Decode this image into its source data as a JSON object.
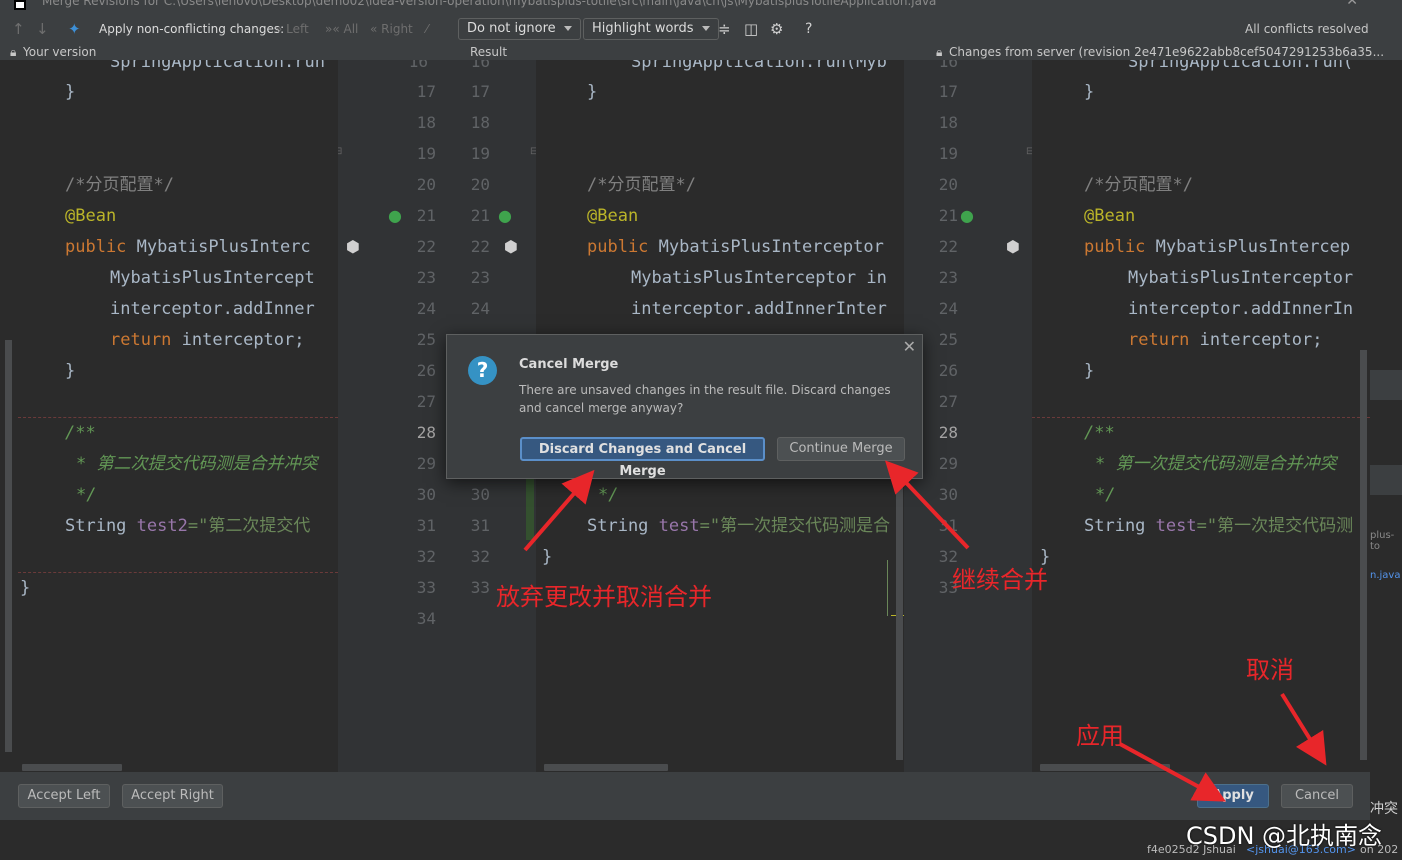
{
  "window": {
    "title": "Merge Revisions for C:\\Users\\lenovo\\Desktop\\demo02\\idea-version-operation\\mybatisplus-totile\\src\\main\\java\\cn\\js\\MybatisplusTotileApplication.java"
  },
  "toolbar": {
    "apply_nonconflicting": "Apply non-conflicting changes:",
    "left": "Left",
    "all": "All",
    "right": "Right",
    "ignore_select": "Do not ignore",
    "highlight_select": "Highlight words",
    "help": "?",
    "status": "All conflicts resolved"
  },
  "header": {
    "left": "Your version",
    "center": "Result",
    "right": "Changes from server (revision 2e471e9622abb8cef5047291253b6a35..."
  },
  "left_lines": [
    "SpringApplication.run",
    "}",
    "/*分页配置*/",
    "@Bean",
    "public",
    "MybatisPlusInterc",
    "MybatisPlusIntercept",
    "interceptor.addInner",
    "return",
    "interceptor;",
    "}",
    "/**",
    "* 第二次提交代码测是合并冲突",
    "*/",
    "String",
    "test2",
    "=\"第二次提交代",
    "}"
  ],
  "center_lines": [
    "SpringApplication.run(Myb",
    "}",
    "/*分页配置*/",
    "@Bean",
    "public",
    "MybatisPlusInterceptor",
    "MybatisPlusInterceptor in",
    "interceptor.addInnerInter",
    "*/",
    "String",
    "test",
    "=\"第一次提交代码测是合",
    "}"
  ],
  "right_lines": [
    "SpringApplication.run(",
    "}",
    "/*分页配置*/",
    "@Bean",
    "public",
    "MybatisPlusIntercep",
    "MybatisPlusInterceptor",
    "interceptor.addInnerIn",
    "return",
    "interceptor;",
    "}",
    "/**",
    "* 第一次提交代码测是合并冲突",
    "*/",
    "String",
    "test",
    "=\"第一次提交代码测"
  ],
  "line_numbers": {
    "a": [
      "16",
      "17",
      "18",
      "19",
      "20",
      "21",
      "22",
      "23",
      "24",
      "25",
      "26",
      "27",
      "28",
      "29",
      "30",
      "31",
      "32",
      "33",
      "34"
    ],
    "b": [
      "16",
      "17",
      "18",
      "19",
      "20",
      "21",
      "22",
      "23",
      "24",
      "25",
      "26",
      "27",
      "28",
      "29",
      "30",
      "31",
      "32",
      "33"
    ],
    "c": [
      "16",
      "17",
      "18",
      "19",
      "20",
      "21",
      "22",
      "23",
      "24",
      "25",
      "26",
      "27",
      "28",
      "29",
      "30",
      "31",
      "32",
      "33"
    ]
  },
  "dialog": {
    "title": "Cancel Merge",
    "message": "There are unsaved changes in the result file. Discard changes and cancel merge anyway?",
    "discard_button": "Discard Changes and Cancel Merge",
    "continue_button": "Continue Merge"
  },
  "bottom": {
    "accept_left": "Accept Left",
    "accept_right": "Accept Right",
    "apply": "Apply",
    "cancel": "Cancel"
  },
  "annotations": {
    "discard": "放弃更改并取消合并",
    "continue": "继续合并",
    "apply": "应用",
    "cancel": "取消",
    "watermark": "CSDN @北执南念"
  },
  "status_bar": {
    "commit": "f4e025d2 Jshuai",
    "email": "<jshuai@163.com>",
    "date": "on 202",
    "right_side_1": "plus-to",
    "right_side_2": "n.java",
    "right_side_3": "冲突"
  },
  "colors": {
    "editor_bg": "#2b2b2b",
    "panel_bg": "#3c3f41",
    "keyword": "#cc7832",
    "annotation": "#bbb529",
    "doc_comment": "#629755",
    "primary_button": "#365880",
    "arrow_red": "#e8262a"
  }
}
